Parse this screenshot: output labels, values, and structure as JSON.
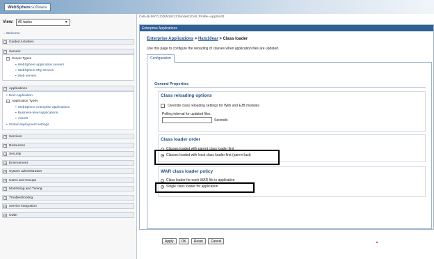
{
  "brand": {
    "name": "WebSphere",
    "suffix": "software"
  },
  "nav": {
    "view_label": "View:",
    "view_value": "All tasks",
    "welcome": "Welcome",
    "guided": "Guided Activities",
    "servers": {
      "label": "Servers",
      "server_types": "Server Types",
      "items": [
        "WebSphere application servers",
        "WebSphere MQ servers",
        "Web servers"
      ]
    },
    "applications": {
      "label": "Applications",
      "new_app": "New Application",
      "app_types": "Application Types",
      "items": [
        "WebSphere enterprise applications",
        "Business-level applications",
        "Assets"
      ],
      "global": "Global deployment settings"
    },
    "sections": [
      "Services",
      "Resources",
      "Security",
      "Environment",
      "System administration",
      "Users and Groups",
      "Monitoring and Tuning",
      "Troubleshooting",
      "Service integration",
      "UDDI"
    ]
  },
  "main": {
    "scope": "Cell=BLMYCLDDW162121Node01Cell, Profile=AppSrv01",
    "panel_title": "Enterprise Applications",
    "breadcrumb": {
      "link1": "Enterprise Applications",
      "sep1": " > ",
      "link2": "Hats10ear",
      "sep2": " > ",
      "current": "Class loader"
    },
    "description": "Use this page to configure the reloading of classes when application files are updated.",
    "tab": "Configuration",
    "general_properties": "General Properties",
    "reloading": {
      "title": "Class reloading options",
      "override": "Override class reloading settings for Web and EJB modules",
      "polling_label": "Polling interval for updated files",
      "seconds": "Seconds"
    },
    "order": {
      "title": "Class loader order",
      "opt1": "Classes loaded with parent class loader first",
      "opt2": "Classes loaded with local class loader first (parent last)"
    },
    "war": {
      "title": "WAR class loader policy",
      "opt1": "Class loader for each WAR file in application",
      "opt2": "Single class loader for application"
    },
    "buttons": [
      "Apply",
      "OK",
      "Reset",
      "Cancel"
    ]
  },
  "colors": {
    "banner": "#7fa3c6",
    "panel_header": "#2f5f95",
    "link": "#2b5a8c",
    "highlight": "#000000",
    "marker": "#e01b24"
  }
}
